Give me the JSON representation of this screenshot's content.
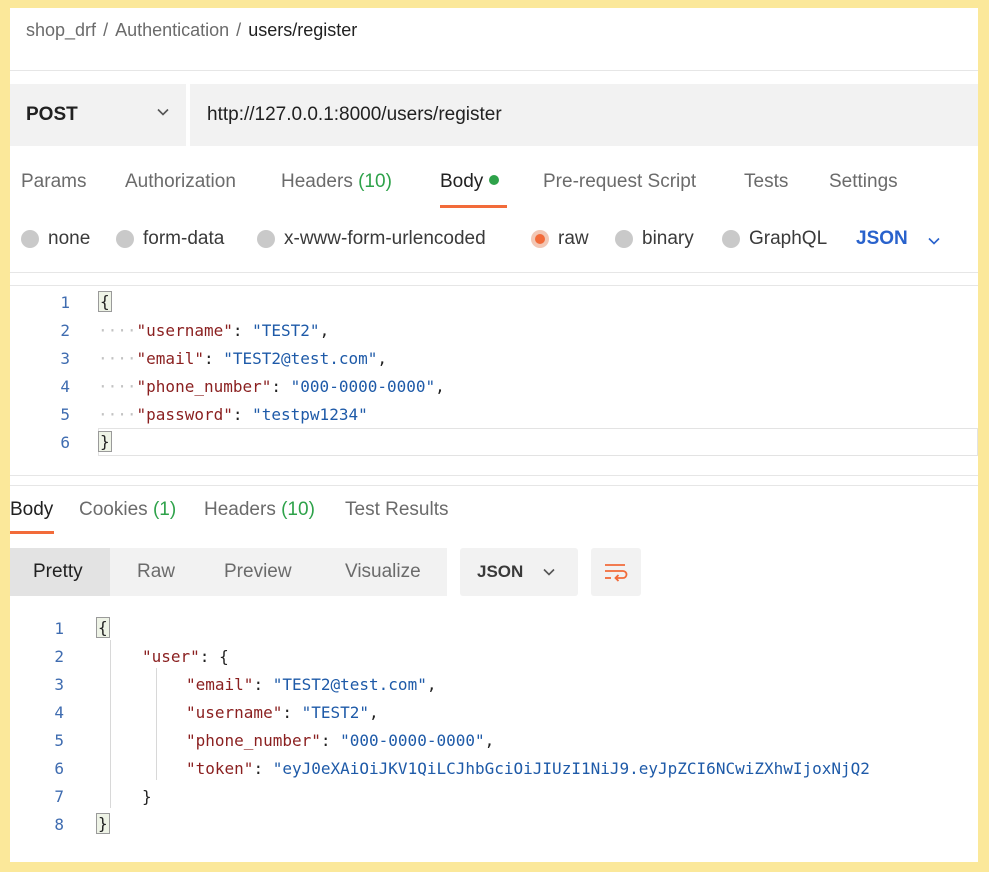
{
  "breadcrumb": {
    "workspace": "shop_drf",
    "collection": "Authentication",
    "request": "users/register",
    "separator": "/"
  },
  "request": {
    "method": "POST",
    "url": "http://127.0.0.1:8000/users/register"
  },
  "request_tabs": {
    "params": "Params",
    "authorization": "Authorization",
    "headers": "Headers",
    "headers_count": "(10)",
    "body": "Body",
    "pre_request_script": "Pre-request Script",
    "tests": "Tests",
    "settings": "Settings"
  },
  "body_types": {
    "none": "none",
    "form_data": "form-data",
    "urlencoded": "x-www-form-urlencoded",
    "raw": "raw",
    "binary": "binary",
    "graphql": "GraphQL",
    "selected_format": "JSON"
  },
  "request_body": {
    "line_numbers": [
      "1",
      "2",
      "3",
      "4",
      "5",
      "6"
    ],
    "open": "{",
    "close": "}",
    "fields": [
      {
        "key": "\"username\"",
        "value": "\"TEST2\"",
        "trail": ","
      },
      {
        "key": "\"email\"",
        "value": "\"TEST2@test.com\"",
        "trail": ","
      },
      {
        "key": "\"phone_number\"",
        "value": "\"000-0000-0000\"",
        "trail": ","
      },
      {
        "key": "\"password\"",
        "value": "\"testpw1234\"",
        "trail": ""
      }
    ]
  },
  "response_tabs": {
    "body": "Body",
    "cookies": "Cookies",
    "cookies_count": "(1)",
    "headers": "Headers",
    "headers_count": "(10)",
    "test_results": "Test Results"
  },
  "view_modes": {
    "pretty": "Pretty",
    "raw": "Raw",
    "preview": "Preview",
    "visualize": "Visualize",
    "format": "JSON"
  },
  "response_body": {
    "line_numbers": [
      "1",
      "2",
      "3",
      "4",
      "5",
      "6",
      "7",
      "8"
    ],
    "open": "{",
    "close": "}",
    "user_key": "\"user\"",
    "user_open": "{",
    "user_close": "}",
    "fields": [
      {
        "key": "\"email\"",
        "value": "\"TEST2@test.com\"",
        "trail": ","
      },
      {
        "key": "\"username\"",
        "value": "\"TEST2\"",
        "trail": ","
      },
      {
        "key": "\"phone_number\"",
        "value": "\"000-0000-0000\"",
        "trail": ","
      },
      {
        "key": "\"token\"",
        "value": "\"eyJ0eXAiOiJKV1QiLCJhbGciOiJIUzI1NiJ9.eyJpZCI6NCwiZXhwIjoxNjQ2",
        "trail": ""
      }
    ]
  },
  "colors": {
    "accent": "#f26b3a",
    "count_green": "#2ea24a",
    "json_blue": "#2962cc",
    "frame": "#fbe89a"
  }
}
